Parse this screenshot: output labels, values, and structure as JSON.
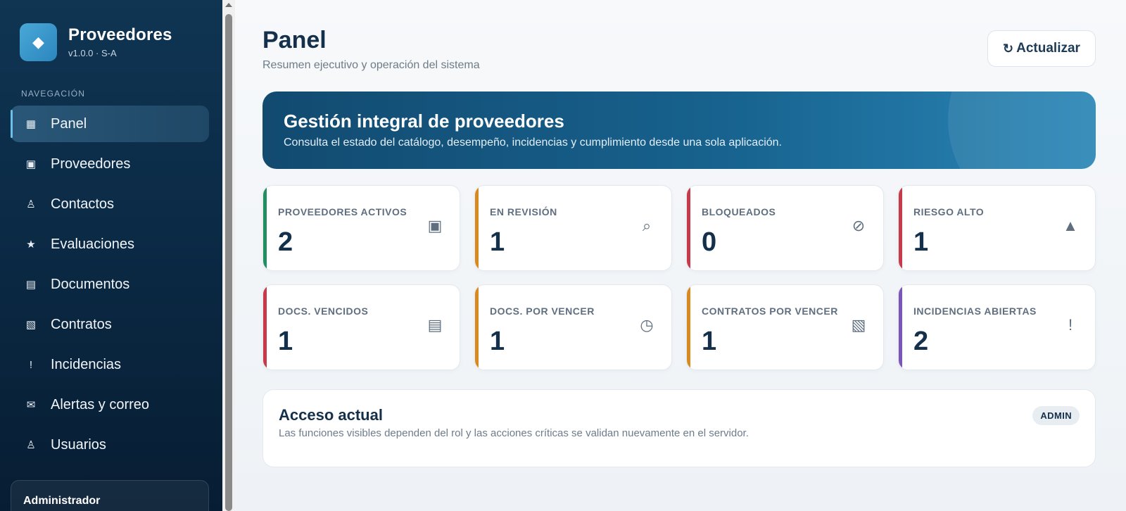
{
  "brand": {
    "logo_glyph": "◆",
    "title": "Proveedores",
    "version": "v1.0.0 · S-A"
  },
  "nav": {
    "caption": "NAVEGACIÓN",
    "items": [
      {
        "label": "Panel",
        "icon": "▦",
        "icon_name": "grid-icon",
        "active": true
      },
      {
        "label": "Proveedores",
        "icon": "▣",
        "icon_name": "box-icon"
      },
      {
        "label": "Contactos",
        "icon": "♙",
        "icon_name": "person-icon"
      },
      {
        "label": "Evaluaciones",
        "icon": "★",
        "icon_name": "star-icon"
      },
      {
        "label": "Documentos",
        "icon": "▤",
        "icon_name": "document-icon"
      },
      {
        "label": "Contratos",
        "icon": "▧",
        "icon_name": "contract-icon"
      },
      {
        "label": "Incidencias",
        "icon": "!",
        "icon_name": "alert-icon"
      },
      {
        "label": "Alertas y correo",
        "icon": "✉",
        "icon_name": "mail-icon"
      },
      {
        "label": "Usuarios",
        "icon": "♙",
        "icon_name": "user-icon"
      }
    ]
  },
  "user": {
    "name": "Administrador"
  },
  "header": {
    "title": "Panel",
    "subtitle": "Resumen ejecutivo y operación del sistema",
    "refresh_icon": "↻",
    "refresh_label": "Actualizar"
  },
  "hero": {
    "title": "Gestión integral de proveedores",
    "text": "Consulta el estado del catálogo, desempeño, incidencias y cumplimiento desde una sola aplicación."
  },
  "cards": [
    {
      "label": "PROVEEDORES ACTIVOS",
      "value": "2",
      "icon": "▣",
      "color": "#1f8f5f"
    },
    {
      "label": "EN REVISIÓN",
      "value": "1",
      "icon": "⌕",
      "color": "#d98a1f"
    },
    {
      "label": "BLOQUEADOS",
      "value": "0",
      "icon": "⊘",
      "color": "#c8394a"
    },
    {
      "label": "RIESGO ALTO",
      "value": "1",
      "icon": "▲",
      "color": "#c8394a"
    },
    {
      "label": "DOCS. VENCIDOS",
      "value": "1",
      "icon": "▤",
      "color": "#c8394a"
    },
    {
      "label": "DOCS. POR VENCER",
      "value": "1",
      "icon": "◷",
      "color": "#d98a1f"
    },
    {
      "label": "CONTRATOS POR VENCER",
      "value": "1",
      "icon": "▧",
      "color": "#d98a1f"
    },
    {
      "label": "INCIDENCIAS ABIERTAS",
      "value": "2",
      "icon": "!",
      "color": "#7b56b8"
    }
  ],
  "access": {
    "title": "Acceso actual",
    "text": "Las funciones visibles dependen del rol y las acciones críticas se validan nuevamente en el servidor.",
    "role_badge": "ADMIN"
  },
  "colors": {
    "sidebar": "#0b2a45",
    "accent": "#17628e",
    "text": "#14304a"
  }
}
